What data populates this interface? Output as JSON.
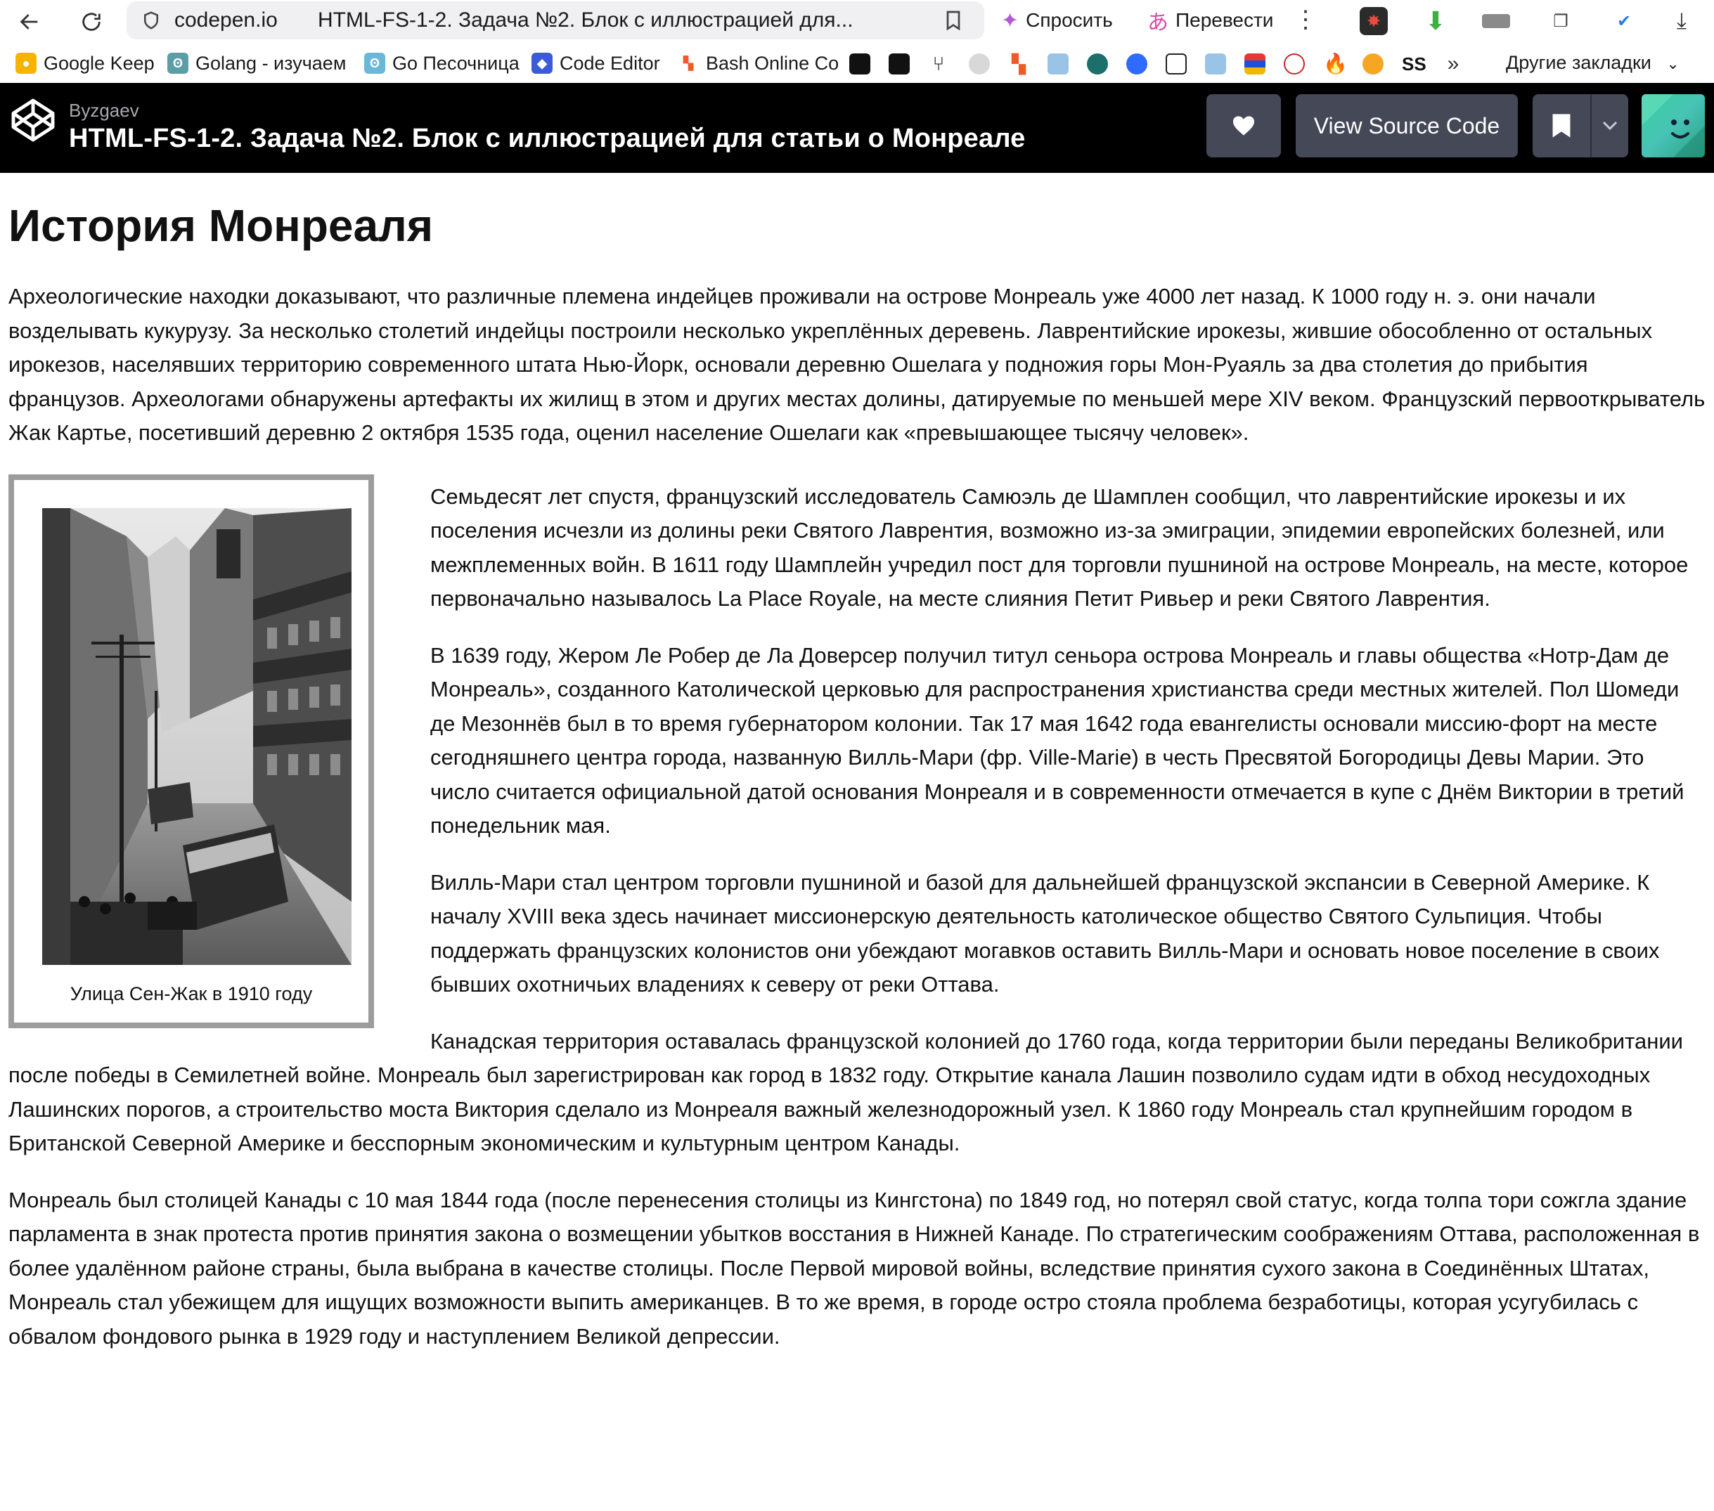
{
  "browser": {
    "domain": "codepen.io",
    "tab_title": "HTML-FS-1-2. Задача №2. Блок с иллюстрацией для...",
    "ask_label": "Спросить",
    "translate_label": "Перевести"
  },
  "bookmarks": {
    "items": [
      {
        "label": "Google Keep",
        "color": "#f6b400"
      },
      {
        "label": "Golang - изучаем",
        "color": "#5c9ea8"
      },
      {
        "label": "Go Песочница",
        "color": "#6ab7d6"
      },
      {
        "label": "Code Editor",
        "color": "#3d5bd9"
      },
      {
        "label": "Bash Online Co",
        "color": "#f05a28"
      }
    ],
    "other_label": "Другие закладки"
  },
  "codepen": {
    "username": "Byzgaev",
    "pen_title": "HTML-FS-1-2. Задача №2. Блок с иллюстрацией для статьи о Монреале",
    "view_source_label": "View Source Code"
  },
  "article": {
    "heading": "История Монреаля",
    "paragraphs": [
      "Археологические находки доказывают, что различные племена индейцев проживали на острове Монреаль уже 4000 лет назад. К 1000 году н. э. они начали возделывать кукурузу. За несколько столетий индейцы построили несколько укреплённых деревень. Лаврентийские ирокезы, жившие обособленно от остальных ирокезов, населявших территорию современного штата Нью-Йорк, основали деревню Ошелага у подножия горы Мон-Руаяль за два столетия до прибытия французов. Археологами обнаружены артефакты их жилищ в этом и других местах долины, датируемые по меньшей мере XIV веком. Французский первооткрыватель Жак Картье, посетивший деревню 2 октября 1535 года, оценил население Ошелаги как «превышающее тысячу человек».",
      "Семьдесят лет спустя, французский исследователь Самюэль де Шамплен сообщил, что лаврентийские ирокезы и их поселения исчезли из долины реки Святого Лаврентия, возможно из-за эмиграции, эпидемии европейских болезней, или межплеменных войн. В 1611 году Шамплейн учредил пост для торговли пушниной на острове Монреаль, на месте, которое первоначально называлось La Place Royale, на месте слияния Петит Ривьер и реки Святого Лаврентия.",
      "В 1639 году, Жером Ле Робер де Ла Доверсер получил титул сеньора острова Монреаль и главы общества «Нотр-Дам де Монреаль», созданного Католической церковью для распространения христианства среди местных жителей. Пол Шомеди де Мезоннёв был в то время губернатором колонии. Так 17 мая 1642 года евангелисты основали миссию-форт на месте сегодняшнего центра города, названную Вилль-Мари (фр. Ville-Marie) в честь Пресвятой Богородицы Девы Марии. Это число считается официальной датой основания Монреаля и в современности отмечается в купе с Днём Виктории в третий понедельник мая.",
      "Вилль-Мари стал центром торговли пушниной и базой для дальнейшей французской экспансии в Северной Америке. К началу XVIII века здесь начинает миссионерскую деятельность католическое общество Святого Сульпиция. Чтобы поддержать французских колонистов они убеждают могавков оставить Вилль-Мари и основать новое поселение в своих бывших охотничьих владениях к северу от реки Оттава.",
      "Канадская территория оставалась французской колонией до 1760 года, когда территории были переданы Великобритании после победы в Семилетней войне. Монреаль был зарегистрирован как город в 1832 году. Открытие канала Лашин позволило судам идти в обход несудоходных Лашинских порогов, а строительство моста Виктория сделало из Монреаля важный железнодорожный узел. К 1860 году Монреаль стал крупнейшим городом в Британской Северной Америке и бесспорным экономическим и культурным центром Канады.",
      "Монреаль был столицей Канады с 10 мая 1844 года (после перенесения столицы из Кингстона) по 1849 год, но потерял свой статус, когда толпа тори сожгла здание парламента в знак протеста против принятия закона о возмещении убытков восстания в Нижней Канаде. По стратегическим соображениям Оттава, расположенная в более удалённом районе страны, была выбрана в качестве столицы. После Первой мировой войны, вследствие принятия сухого закона в Соединённых Штатах, Монреаль стал убежищем для ищущих возможности выпить американцев. В то же время, в городе остро стояла проблема безработицы, которая усугубилась с обвалом фондового рынка в 1929 году и наступлением Великой депрессии."
    ],
    "figure_caption": "Улица Сен-Жак в 1910 году"
  }
}
